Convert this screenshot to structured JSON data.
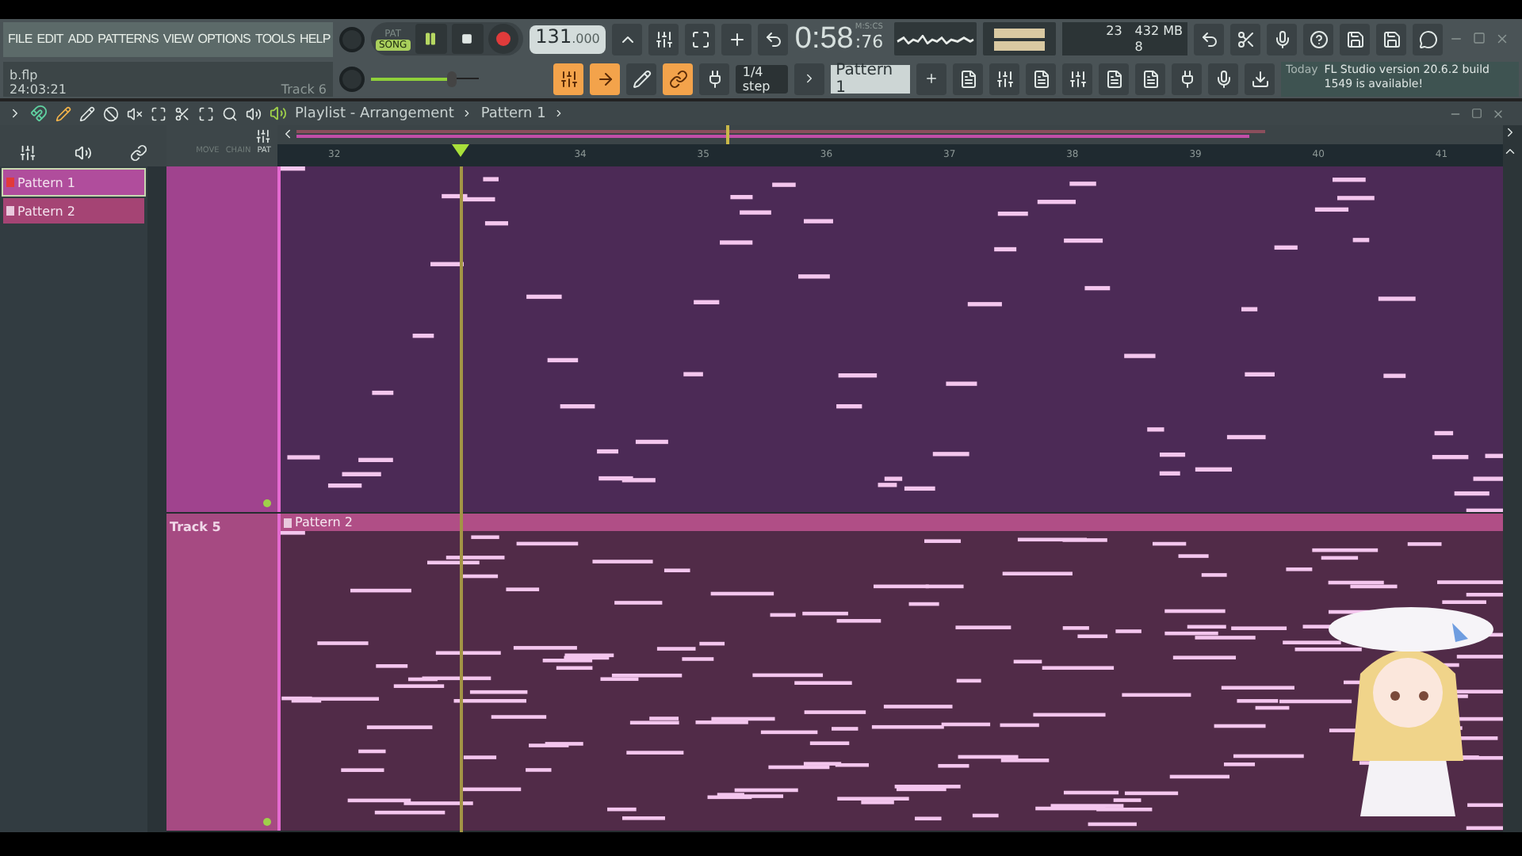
{
  "menu": [
    "FILE",
    "EDIT",
    "ADD",
    "PATTERNS",
    "VIEW",
    "OPTIONS",
    "TOOLS",
    "HELP"
  ],
  "transport": {
    "pat_label": "PAT",
    "song_label": "SONG",
    "song_selected": true,
    "playing": true,
    "tempo": "131",
    "tempo_fraction": ".000"
  },
  "clock": {
    "time": "0:58",
    "hundredths": ":76",
    "unit": "M:S:CS"
  },
  "monitor": {
    "cpu": "23",
    "memory": "432 MB",
    "polyphony": "8"
  },
  "project": {
    "file": "b.flp",
    "time": "24:03:21",
    "hint": "Track 6"
  },
  "master_volume": {
    "level": 0.75
  },
  "snap": "1/4 step",
  "pattern_selector": "Pattern 1",
  "news": {
    "date": "Today",
    "message": "FL Studio version 20.6.2 build 1549 is available!"
  },
  "playlist": {
    "breadcrumb": [
      "Playlist - Arrangement",
      "Pattern 1"
    ],
    "tool_labels": [
      "MOVE",
      "CHAIN",
      "PAT"
    ]
  },
  "patterns": [
    {
      "name": "Pattern 1",
      "selected": true
    },
    {
      "name": "Pattern 2",
      "selected": false
    }
  ],
  "ruler": [
    "32",
    "34",
    "35",
    "36",
    "37",
    "38",
    "39",
    "40",
    "41"
  ],
  "tracks": [
    {
      "kind": "open"
    },
    {
      "kind": "titled",
      "name": "Track 5",
      "clip": "Pattern 2"
    }
  ]
}
